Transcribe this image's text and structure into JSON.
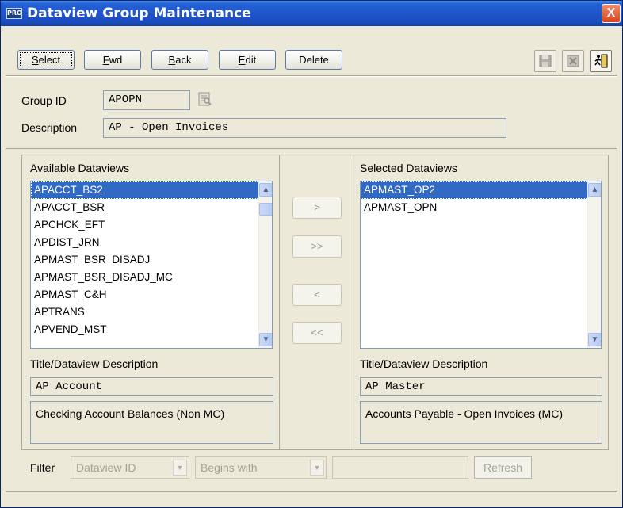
{
  "window": {
    "title": "Dataview Group Maintenance",
    "app_icon_text": "PRO",
    "close_glyph": "X"
  },
  "toolbar": {
    "buttons": [
      {
        "label": "Select",
        "mnemonic": "S"
      },
      {
        "label": "Fwd",
        "mnemonic": "F"
      },
      {
        "label": "Back",
        "mnemonic": "B"
      },
      {
        "label": "Edit",
        "mnemonic": "E"
      },
      {
        "label": "Delete",
        "mnemonic": ""
      }
    ],
    "icons": [
      "save-icon",
      "cancel-icon",
      "exit-icon"
    ]
  },
  "form": {
    "group_id_label": "Group ID",
    "group_id_value": "APOPN",
    "description_label": "Description",
    "description_value": "AP - Open Invoices"
  },
  "available": {
    "heading": "Available Dataviews",
    "items": [
      "APACCT_BS2",
      "APACCT_BSR",
      "APCHCK_EFT",
      "APDIST_JRN",
      "APMAST_BSR_DISADJ",
      "APMAST_BSR_DISADJ_MC",
      "APMAST_C&H",
      "APTRANS",
      "APVEND_MST"
    ],
    "selected_index": 0,
    "desc_heading": "Title/Dataview Description",
    "title_value": "AP Account",
    "description_value": "Checking Account Balances (Non MC)"
  },
  "move_buttons": [
    ">",
    ">>",
    "<",
    "<<"
  ],
  "selected": {
    "heading": "Selected Dataviews",
    "items": [
      "APMAST_OP2",
      "APMAST_OPN"
    ],
    "selected_index": 0,
    "desc_heading": "Title/Dataview Description",
    "title_value": "AP Master",
    "description_value": "Accounts Payable - Open Invoices (MC)"
  },
  "filter": {
    "label": "Filter",
    "field_value": "Dataview ID",
    "operator_value": "Begins with",
    "text_value": "",
    "refresh_label": "Refresh"
  },
  "colors": {
    "titlebar": "#2462d6",
    "selection": "#316ac5",
    "window_bg": "#ece9d8"
  }
}
